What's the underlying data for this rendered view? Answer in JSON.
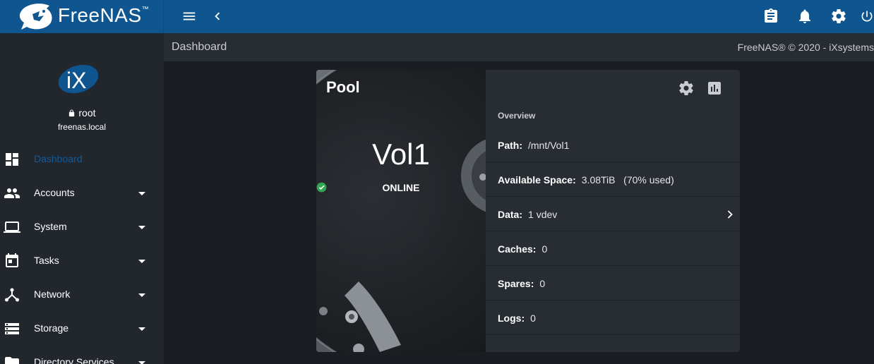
{
  "topbar": {
    "brand": "FreeNAS",
    "brand_tm": "™",
    "icons": [
      "menu-icon",
      "chevron-left-icon",
      "clipboard-icon",
      "bell-icon",
      "gear-icon",
      "power-icon"
    ]
  },
  "sidebar": {
    "user": {
      "name": "root",
      "host": "freenas.local"
    },
    "items": [
      {
        "label": "Dashboard",
        "icon": "dashboard-icon",
        "active": true
      },
      {
        "label": "Accounts",
        "icon": "people-icon"
      },
      {
        "label": "System",
        "icon": "laptop-icon"
      },
      {
        "label": "Tasks",
        "icon": "calendar-icon"
      },
      {
        "label": "Network",
        "icon": "network-icon"
      },
      {
        "label": "Storage",
        "icon": "storage-icon"
      },
      {
        "label": "Directory Services",
        "icon": "directory-icon"
      }
    ]
  },
  "breadcrumb": {
    "current": "Dashboard",
    "copyright": "FreeNAS® © 2020 - iXsystems"
  },
  "colors": {
    "brand_blue": "#0f558f",
    "active_nav": "#0e5a9d",
    "online_green": "#2fa84f"
  },
  "card": {
    "title": "Pool",
    "pool_name": "Vol1",
    "status": "ONLINE",
    "overview_label": "Overview",
    "rows": [
      {
        "label": "Path:",
        "value": "/mnt/Vol1"
      },
      {
        "label": "Available Space:",
        "value": "3.08TiB   (70% used)"
      },
      {
        "label": "Data:",
        "value": "1 vdev"
      },
      {
        "label": "Caches:",
        "value": "0"
      },
      {
        "label": "Spares:",
        "value": "0"
      },
      {
        "label": "Logs:",
        "value": "0"
      }
    ]
  }
}
